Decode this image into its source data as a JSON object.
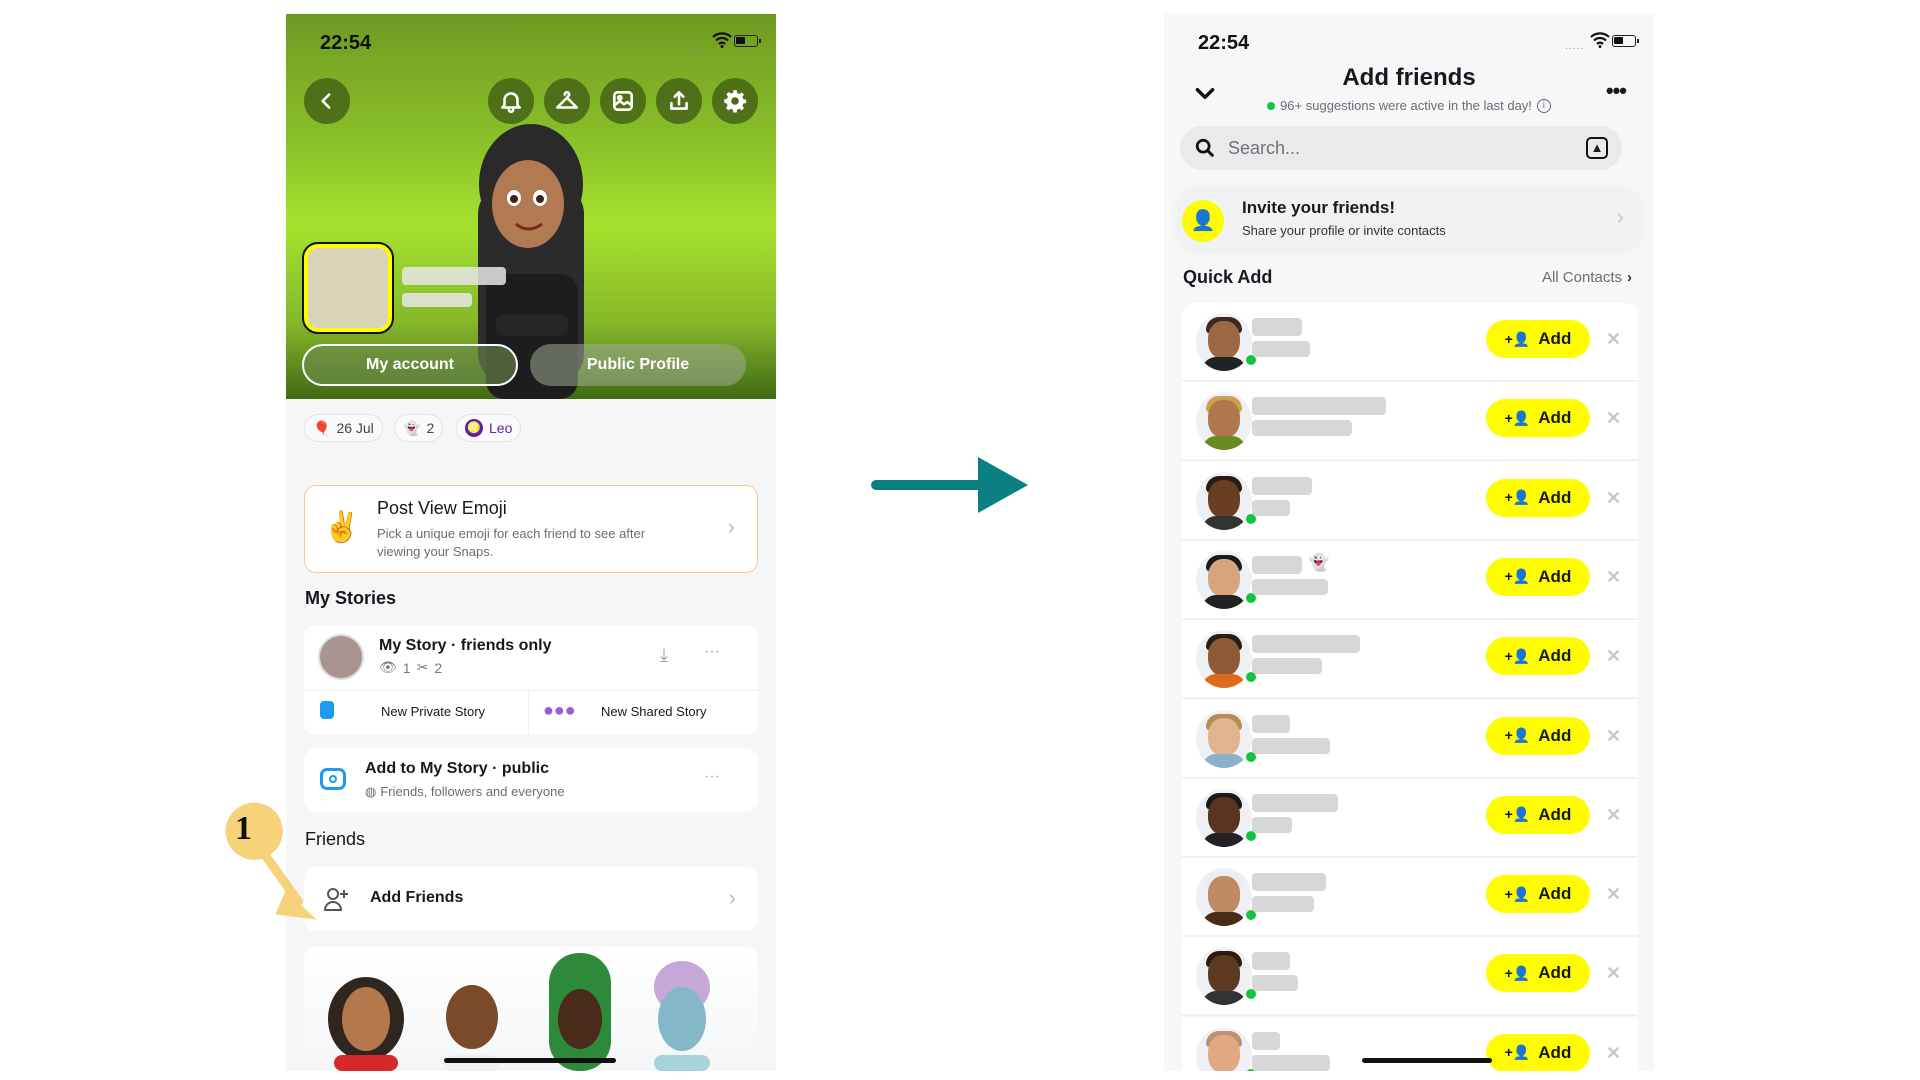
{
  "left_screen": {
    "status": {
      "time": "22:54",
      "signal": "....."
    },
    "header_icons": [
      "back-icon",
      "bell-icon",
      "hanger-icon",
      "gallery-icon",
      "share-icon",
      "gear-icon"
    ],
    "buttons": {
      "my_account": "My account",
      "public_profile": "Public Profile"
    },
    "chips": [
      {
        "icon": "balloon-icon",
        "label": "26 Jul"
      },
      {
        "icon": "ghost-icon",
        "label": "2"
      },
      {
        "icon": "leo-zodiac-icon",
        "label": "Leo"
      }
    ],
    "post_view_emoji": {
      "emoji": "✌️",
      "title": "Post View Emoji",
      "subtitle_line1": "Pick a unique emoji for each friend to see after",
      "subtitle_line2": "viewing your Snaps."
    },
    "my_stories": {
      "section_title": "My Stories",
      "story_title": "My Story · friends only",
      "views": "1",
      "screenshots": "2",
      "new_private": "New Private Story",
      "new_shared": "New Shared Story",
      "public_title": "Add to My Story · public",
      "public_subtitle": "Friends, followers and everyone"
    },
    "friends": {
      "section_title": "Friends",
      "add_friends": "Add Friends"
    },
    "annotation": {
      "step": "1",
      "color": "#f6d27a"
    }
  },
  "arrow": {
    "color": "#0a8083"
  },
  "right_screen": {
    "status": {
      "time": "22:54",
      "signal": "....."
    },
    "title": "Add friends",
    "subtitle": "96+ suggestions were active in the last day!",
    "search_placeholder": "Search...",
    "invite": {
      "title": "Invite your friends!",
      "subtitle": "Share your profile or invite contacts"
    },
    "quick_add": {
      "title": "Quick Add",
      "all_contacts": "All Contacts"
    },
    "add_label": "Add",
    "accent": "#fffc00",
    "online_color": "#14c43f",
    "rows": [
      {
        "name_blur": true,
        "emoji": "",
        "online": true
      },
      {
        "name_blur": true,
        "emoji": "",
        "online": false
      },
      {
        "name_blur": true,
        "emoji": "",
        "online": true
      },
      {
        "name_blur": true,
        "emoji": "👻",
        "online": true
      },
      {
        "name_blur": true,
        "emoji": "",
        "online": true
      },
      {
        "name_blur": true,
        "emoji": "",
        "online": true
      },
      {
        "name_blur": true,
        "emoji": "",
        "online": true
      },
      {
        "name_blur": true,
        "emoji": "",
        "online": true
      },
      {
        "name_blur": true,
        "emoji": "",
        "online": true
      },
      {
        "name_blur": true,
        "emoji": "",
        "online": true
      }
    ]
  }
}
